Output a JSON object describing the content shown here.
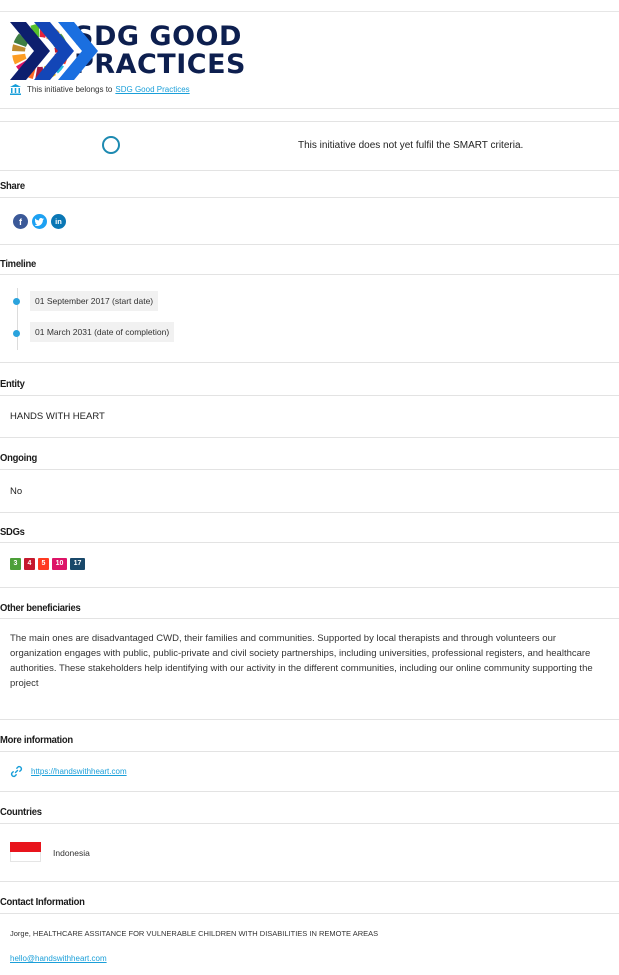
{
  "logo": {
    "line1": "SDG GOOD",
    "line2": "PRACTICES"
  },
  "belongs": {
    "prefix": "This initiative belongs to",
    "link": "SDG Good Practices"
  },
  "smart": {
    "text": "This initiative does not yet fulfil the SMART criteria."
  },
  "share": {
    "heading": "Share",
    "networks": [
      "facebook",
      "twitter",
      "linkedin"
    ]
  },
  "timeline": {
    "heading": "Timeline",
    "start": "01 September 2017 (start date)",
    "end": "01 March 2031 (date of completion)"
  },
  "entity": {
    "heading": "Entity",
    "value": "HANDS WITH HEART"
  },
  "ongoing": {
    "heading": "Ongoing",
    "value": "No"
  },
  "sdgs": {
    "heading": "SDGs",
    "badges": [
      {
        "label": "3",
        "color": "#4c9f38"
      },
      {
        "label": "4",
        "color": "#c5192d"
      },
      {
        "label": "5",
        "color": "#ff3a21"
      },
      {
        "label": "10",
        "color": "#dd1367"
      },
      {
        "label": "17",
        "color": "#19486a"
      }
    ]
  },
  "beneficiaries": {
    "heading": "Other beneficiaries",
    "text": "The main ones are disadvantaged CWD, their families and communities. Supported by local therapists and through volunteers our organization engages with public, public-private and civil society partnerships, including universities, professional registers, and healthcare authorities. These stakeholders help identifying with our activity in the different communities, including our online community supporting the project"
  },
  "more_info": {
    "heading": "More information",
    "link": "https://handswithheart.com"
  },
  "countries": {
    "heading": "Countries",
    "items": [
      "Indonesia"
    ]
  },
  "contact": {
    "heading": "Contact Information",
    "person": "Jorge, HEALTHCARE ASSITANCE FOR VULNERABLE CHILDREN WITH DISABILITIES IN REMOTE AREAS",
    "email": "hello@handswithheart.com"
  },
  "colors": {
    "accent": "#1a9fd9",
    "navy": "#0d1f4f",
    "facebook": "#3b5998",
    "twitter": "#1da1f2",
    "linkedin": "#0a77b5"
  }
}
